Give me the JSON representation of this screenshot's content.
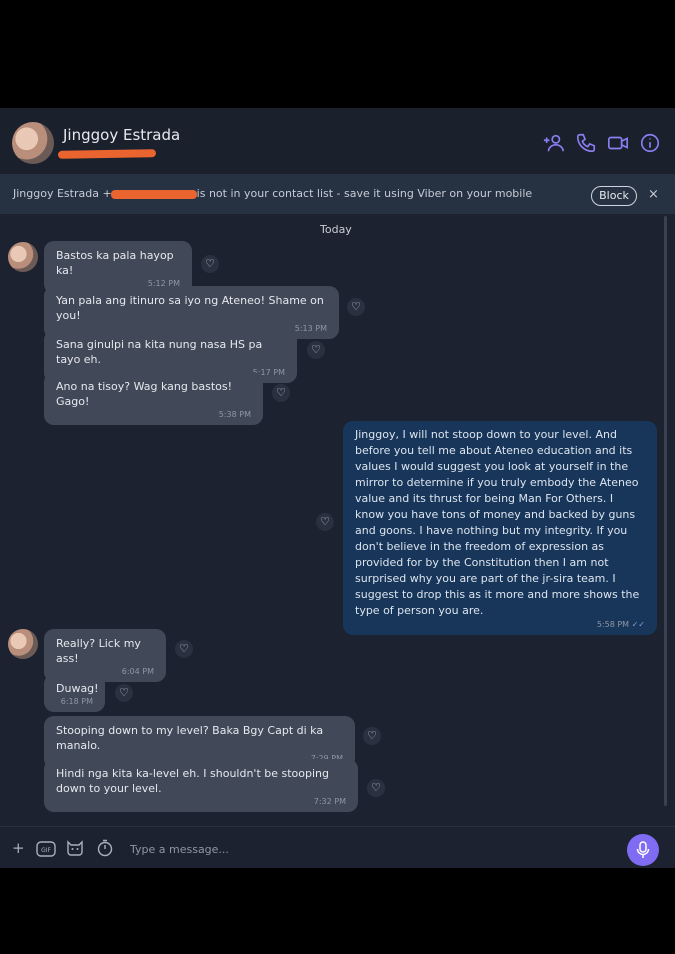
{
  "header": {
    "contact_name": "Jinggoy Estrada",
    "icons": [
      "add-contact-icon",
      "phone-icon",
      "video-icon",
      "info-icon"
    ]
  },
  "notice": {
    "prefix": "Jinggoy Estrada +",
    "suffix": "is not in your contact list - save it using Viber on your mobile",
    "block_label": "Block",
    "close_label": "×"
  },
  "date_label": "Today",
  "messages": [
    {
      "text": "Bastos ka pala hayop ka!",
      "time": "5:12 PM"
    },
    {
      "text": "Yan pala ang itinuro sa iyo ng Ateneo! Shame on you!",
      "time": "5:13 PM"
    },
    {
      "text": "Sana ginulpi na kita nung nasa HS pa tayo eh.",
      "time": "5:17 PM"
    },
    {
      "text": "Ano na tisoy? Wag kang bastos! Gago!",
      "time": "5:38 PM"
    },
    {
      "text": "Jinggoy, I will not stoop down to your level. And before you tell me about Ateneo education and its values I would suggest you look at yourself in the mirror to determine if you truly embody the Ateneo value and its thrust for being Man For Others. I know you have tons of money and backed by guns and goons. I have nothing but my integrity. If you don't believe in the freedom of expression as provided for by the Constitution then I am not surprised why you are part of the jr-sira team. I suggest to drop this as it more and more shows the type of person you are.",
      "time": "5:58 PM"
    },
    {
      "text": "Really? Lick my ass!",
      "time": "6:04 PM"
    },
    {
      "text": "Duwag!",
      "time": "6:18 PM"
    },
    {
      "text": "Stooping down to my level? Baka Bgy Capt di ka manalo.",
      "time": "7:29 PM"
    },
    {
      "text": "Hindi nga kita ka-level eh. I shouldn't be stooping down to your level.",
      "time": "7:32 PM"
    }
  ],
  "composer": {
    "placeholder": "Type a message...",
    "icons": [
      "plus-icon",
      "gif-icon",
      "sticker-icon",
      "timer-icon",
      "microphone-icon"
    ]
  },
  "colors": {
    "window_bg": "#1d2230",
    "incoming_bubble": "#414958",
    "outgoing_bubble": "#173659",
    "accent": "#7f6cf2",
    "redaction": "#e9642f"
  }
}
